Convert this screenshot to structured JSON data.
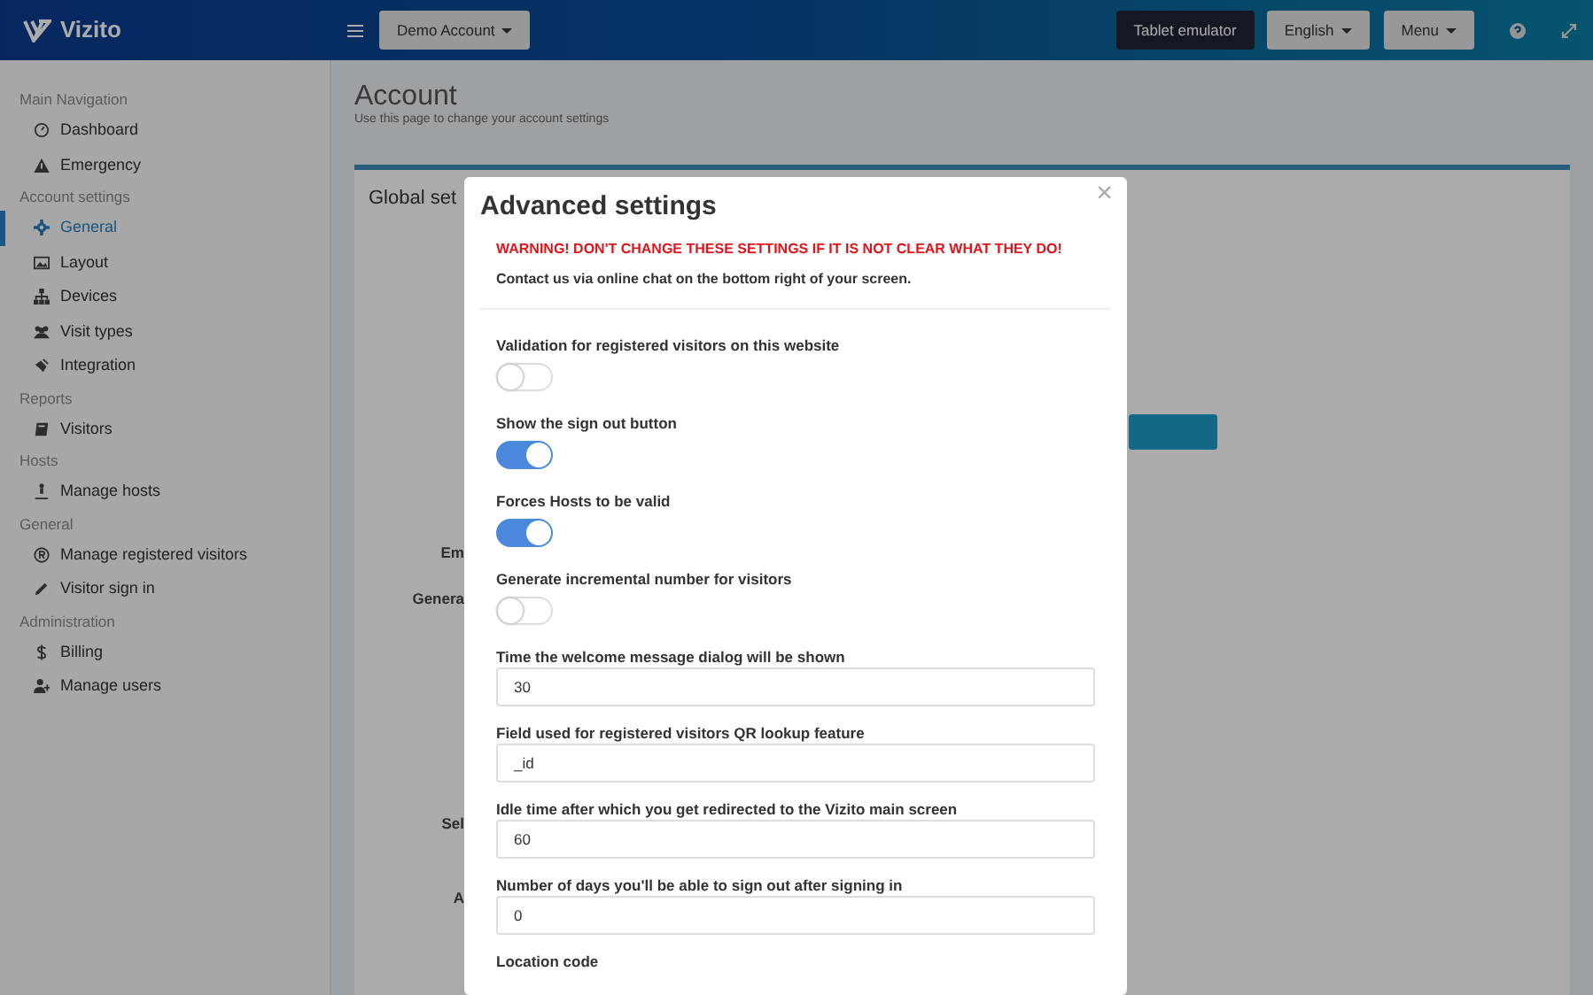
{
  "header": {
    "logo_text": "Vizito",
    "account_button": "Demo Account",
    "tablet_button": "Tablet emulator",
    "language_button": "English",
    "menu_button": "Menu"
  },
  "sidebar": {
    "sections": [
      {
        "title": "Main Navigation",
        "items": [
          {
            "label": "Dashboard",
            "selected": false
          },
          {
            "label": "Emergency",
            "selected": false
          }
        ]
      },
      {
        "title": "Account settings",
        "items": [
          {
            "label": "General",
            "selected": true
          },
          {
            "label": "Layout",
            "selected": false
          },
          {
            "label": "Devices",
            "selected": false
          },
          {
            "label": "Visit types",
            "selected": false
          },
          {
            "label": "Integration",
            "selected": false
          }
        ]
      },
      {
        "title": "Reports",
        "items": [
          {
            "label": "Visitors",
            "selected": false
          }
        ]
      },
      {
        "title": "Hosts",
        "items": [
          {
            "label": "Manage hosts",
            "selected": false
          }
        ]
      },
      {
        "title": "General",
        "items": [
          {
            "label": "Manage registered visitors",
            "selected": false
          },
          {
            "label": "Visitor sign in",
            "selected": false
          }
        ]
      },
      {
        "title": "Administration",
        "items": [
          {
            "label": "Billing",
            "selected": false
          },
          {
            "label": "Manage users",
            "selected": false
          }
        ]
      }
    ]
  },
  "page": {
    "title": "Account",
    "subtitle": "Use this page to change your account settings",
    "card_title": "Global set",
    "form_labels": [
      "Em",
      "Genera",
      "Sel",
      "A"
    ]
  },
  "modal": {
    "title": "Advanced settings",
    "close": "×",
    "warning": "WARNING! DON'T CHANGE THESE SETTINGS IF IT IS NOT CLEAR WHAT THEY DO!",
    "note": "Contact us via online chat on the bottom right of your screen.",
    "settings": [
      {
        "kind": "toggle",
        "label": "Validation for registered visitors on this website",
        "on": false
      },
      {
        "kind": "toggle",
        "label": "Show the sign out button",
        "on": true
      },
      {
        "kind": "toggle",
        "label": "Forces Hosts to be valid",
        "on": true
      },
      {
        "kind": "toggle",
        "label": "Generate incremental number for visitors",
        "on": false
      },
      {
        "kind": "input",
        "label": "Time the welcome message dialog will be shown",
        "value": "30"
      },
      {
        "kind": "input",
        "label": "Field used for registered visitors QR lookup feature",
        "value": "_id"
      },
      {
        "kind": "input",
        "label": "Idle time after which you get redirected to the Vizito main screen",
        "value": "60"
      },
      {
        "kind": "input",
        "label": "Number of days you'll be able to sign out after signing in",
        "value": "0"
      },
      {
        "kind": "label",
        "label": "Location code"
      }
    ]
  }
}
